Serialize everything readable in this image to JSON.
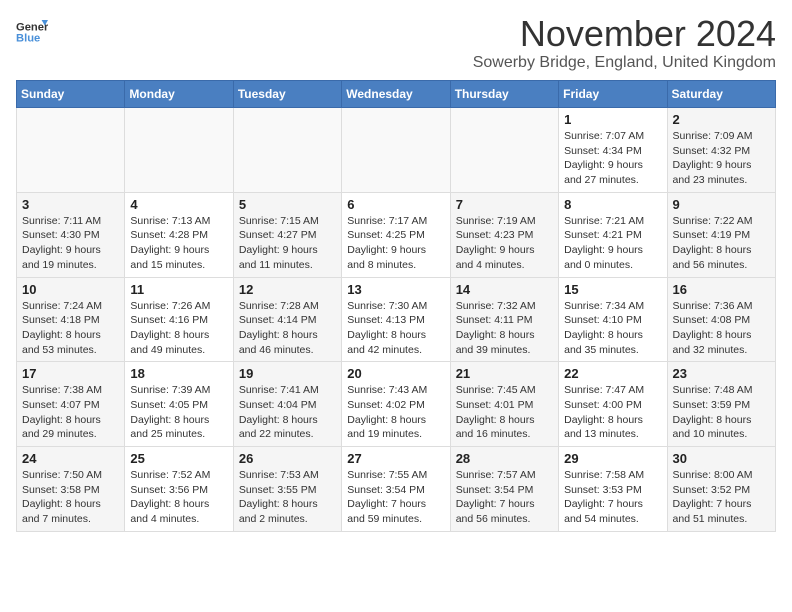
{
  "logo": {
    "line1": "General",
    "line2": "Blue"
  },
  "title": "November 2024",
  "subtitle": "Sowerby Bridge, England, United Kingdom",
  "days_of_week": [
    "Sunday",
    "Monday",
    "Tuesday",
    "Wednesday",
    "Thursday",
    "Friday",
    "Saturday"
  ],
  "weeks": [
    [
      {
        "day": "",
        "info": ""
      },
      {
        "day": "",
        "info": ""
      },
      {
        "day": "",
        "info": ""
      },
      {
        "day": "",
        "info": ""
      },
      {
        "day": "",
        "info": ""
      },
      {
        "day": "1",
        "info": "Sunrise: 7:07 AM\nSunset: 4:34 PM\nDaylight: 9 hours and 27 minutes."
      },
      {
        "day": "2",
        "info": "Sunrise: 7:09 AM\nSunset: 4:32 PM\nDaylight: 9 hours and 23 minutes."
      }
    ],
    [
      {
        "day": "3",
        "info": "Sunrise: 7:11 AM\nSunset: 4:30 PM\nDaylight: 9 hours and 19 minutes."
      },
      {
        "day": "4",
        "info": "Sunrise: 7:13 AM\nSunset: 4:28 PM\nDaylight: 9 hours and 15 minutes."
      },
      {
        "day": "5",
        "info": "Sunrise: 7:15 AM\nSunset: 4:27 PM\nDaylight: 9 hours and 11 minutes."
      },
      {
        "day": "6",
        "info": "Sunrise: 7:17 AM\nSunset: 4:25 PM\nDaylight: 9 hours and 8 minutes."
      },
      {
        "day": "7",
        "info": "Sunrise: 7:19 AM\nSunset: 4:23 PM\nDaylight: 9 hours and 4 minutes."
      },
      {
        "day": "8",
        "info": "Sunrise: 7:21 AM\nSunset: 4:21 PM\nDaylight: 9 hours and 0 minutes."
      },
      {
        "day": "9",
        "info": "Sunrise: 7:22 AM\nSunset: 4:19 PM\nDaylight: 8 hours and 56 minutes."
      }
    ],
    [
      {
        "day": "10",
        "info": "Sunrise: 7:24 AM\nSunset: 4:18 PM\nDaylight: 8 hours and 53 minutes."
      },
      {
        "day": "11",
        "info": "Sunrise: 7:26 AM\nSunset: 4:16 PM\nDaylight: 8 hours and 49 minutes."
      },
      {
        "day": "12",
        "info": "Sunrise: 7:28 AM\nSunset: 4:14 PM\nDaylight: 8 hours and 46 minutes."
      },
      {
        "day": "13",
        "info": "Sunrise: 7:30 AM\nSunset: 4:13 PM\nDaylight: 8 hours and 42 minutes."
      },
      {
        "day": "14",
        "info": "Sunrise: 7:32 AM\nSunset: 4:11 PM\nDaylight: 8 hours and 39 minutes."
      },
      {
        "day": "15",
        "info": "Sunrise: 7:34 AM\nSunset: 4:10 PM\nDaylight: 8 hours and 35 minutes."
      },
      {
        "day": "16",
        "info": "Sunrise: 7:36 AM\nSunset: 4:08 PM\nDaylight: 8 hours and 32 minutes."
      }
    ],
    [
      {
        "day": "17",
        "info": "Sunrise: 7:38 AM\nSunset: 4:07 PM\nDaylight: 8 hours and 29 minutes."
      },
      {
        "day": "18",
        "info": "Sunrise: 7:39 AM\nSunset: 4:05 PM\nDaylight: 8 hours and 25 minutes."
      },
      {
        "day": "19",
        "info": "Sunrise: 7:41 AM\nSunset: 4:04 PM\nDaylight: 8 hours and 22 minutes."
      },
      {
        "day": "20",
        "info": "Sunrise: 7:43 AM\nSunset: 4:02 PM\nDaylight: 8 hours and 19 minutes."
      },
      {
        "day": "21",
        "info": "Sunrise: 7:45 AM\nSunset: 4:01 PM\nDaylight: 8 hours and 16 minutes."
      },
      {
        "day": "22",
        "info": "Sunrise: 7:47 AM\nSunset: 4:00 PM\nDaylight: 8 hours and 13 minutes."
      },
      {
        "day": "23",
        "info": "Sunrise: 7:48 AM\nSunset: 3:59 PM\nDaylight: 8 hours and 10 minutes."
      }
    ],
    [
      {
        "day": "24",
        "info": "Sunrise: 7:50 AM\nSunset: 3:58 PM\nDaylight: 8 hours and 7 minutes."
      },
      {
        "day": "25",
        "info": "Sunrise: 7:52 AM\nSunset: 3:56 PM\nDaylight: 8 hours and 4 minutes."
      },
      {
        "day": "26",
        "info": "Sunrise: 7:53 AM\nSunset: 3:55 PM\nDaylight: 8 hours and 2 minutes."
      },
      {
        "day": "27",
        "info": "Sunrise: 7:55 AM\nSunset: 3:54 PM\nDaylight: 7 hours and 59 minutes."
      },
      {
        "day": "28",
        "info": "Sunrise: 7:57 AM\nSunset: 3:54 PM\nDaylight: 7 hours and 56 minutes."
      },
      {
        "day": "29",
        "info": "Sunrise: 7:58 AM\nSunset: 3:53 PM\nDaylight: 7 hours and 54 minutes."
      },
      {
        "day": "30",
        "info": "Sunrise: 8:00 AM\nSunset: 3:52 PM\nDaylight: 7 hours and 51 minutes."
      }
    ]
  ]
}
